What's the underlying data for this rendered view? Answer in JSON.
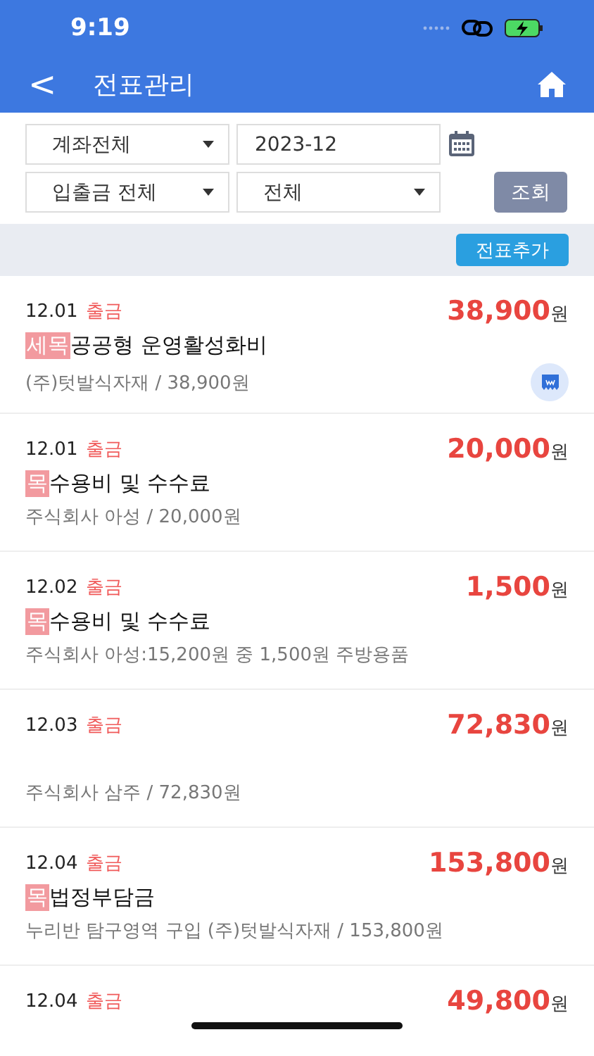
{
  "status_bar": {
    "time": "9:19"
  },
  "header": {
    "back": "<",
    "title": "전표관리"
  },
  "filters": {
    "account": "계좌전체",
    "month": "2023-12",
    "direction": "입출금 전체",
    "category": "전체",
    "search_button": "조회"
  },
  "add_button": "전표추가",
  "entries": [
    {
      "date": "12.01",
      "type": "출금",
      "amount": "38,900",
      "unit": "원",
      "tag": "세목",
      "title": "공공형 운영활성화비",
      "detail": "(주)텃발식자재 / 38,900원",
      "receipt": true
    },
    {
      "date": "12.01",
      "type": "출금",
      "amount": "20,000",
      "unit": "원",
      "tag": "목",
      "title": "수용비 및 수수료",
      "detail": "주식회사 아성 / 20,000원",
      "receipt": false
    },
    {
      "date": "12.02",
      "type": "출금",
      "amount": "1,500",
      "unit": "원",
      "tag": "목",
      "title": "수용비 및 수수료",
      "detail": "주식회사 아성:15,200원 중 1,500원 주방용품",
      "receipt": false
    },
    {
      "date": "12.03",
      "type": "출금",
      "amount": "72,830",
      "unit": "원",
      "detail": "주식회사 삼주 / 72,830원",
      "receipt": false
    },
    {
      "date": "12.04",
      "type": "출금",
      "amount": "153,800",
      "unit": "원",
      "tag": "목",
      "title": "법정부담금",
      "detail": "누리반 탐구영역 구입 (주)텃발식자재 / 153,800원",
      "receipt": false
    },
    {
      "date": "12.04",
      "type": "출금",
      "amount": "49,800",
      "unit": "원",
      "receipt": false
    }
  ]
}
